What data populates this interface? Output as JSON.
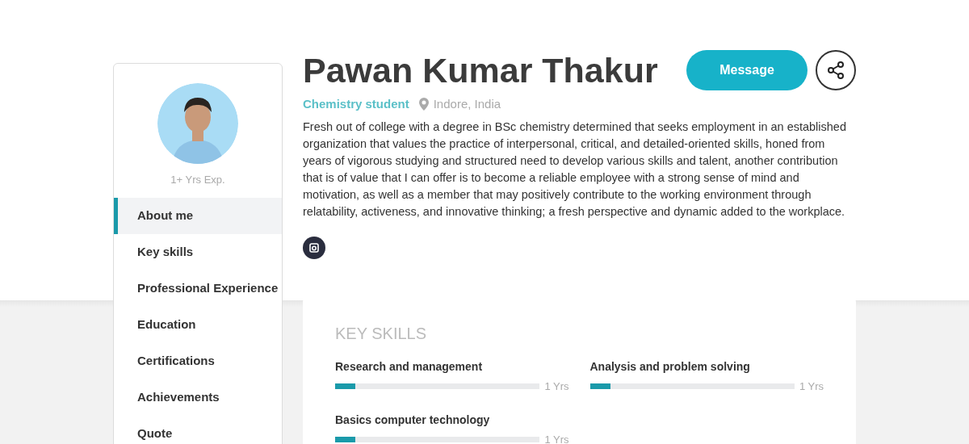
{
  "sidebar": {
    "experience": "1+ Yrs Exp.",
    "items": [
      {
        "label": "About me",
        "selected": true
      },
      {
        "label": "Key skills",
        "selected": false
      },
      {
        "label": "Professional Experience",
        "selected": false
      },
      {
        "label": "Education",
        "selected": false
      },
      {
        "label": "Certifications",
        "selected": false
      },
      {
        "label": "Achievements",
        "selected": false
      },
      {
        "label": "Quote",
        "selected": false
      }
    ]
  },
  "profile": {
    "name": "Pawan Kumar Thakur",
    "title": "Chemistry student",
    "location": "Indore, India",
    "message_button": "Message",
    "about": "Fresh out of college with a degree in BSc chemistry determined that seeks employment in an established organization that values the practice of interpersonal, critical, and detailed-oriented skills, honed from years of vigorous studying and structured need to develop various skills and talent, another contribution that is of value that I can offer is to become a reliable employee with a strong sense of mind and motivation, as well as a member that may positively contribute to the working environment through relatability, activeness, and innovative thinking; a fresh perspective and dynamic added to the workplace."
  },
  "key_skills": {
    "heading": "KEY SKILLS",
    "skills": [
      {
        "name": "Research and management",
        "level": 0.1,
        "reading": "1 Yrs"
      },
      {
        "name": "Analysis and problem solving",
        "level": 0.1,
        "reading": "1 Yrs"
      },
      {
        "name": "Basics computer technology",
        "level": 0.1,
        "reading": "1 Yrs"
      }
    ]
  }
}
